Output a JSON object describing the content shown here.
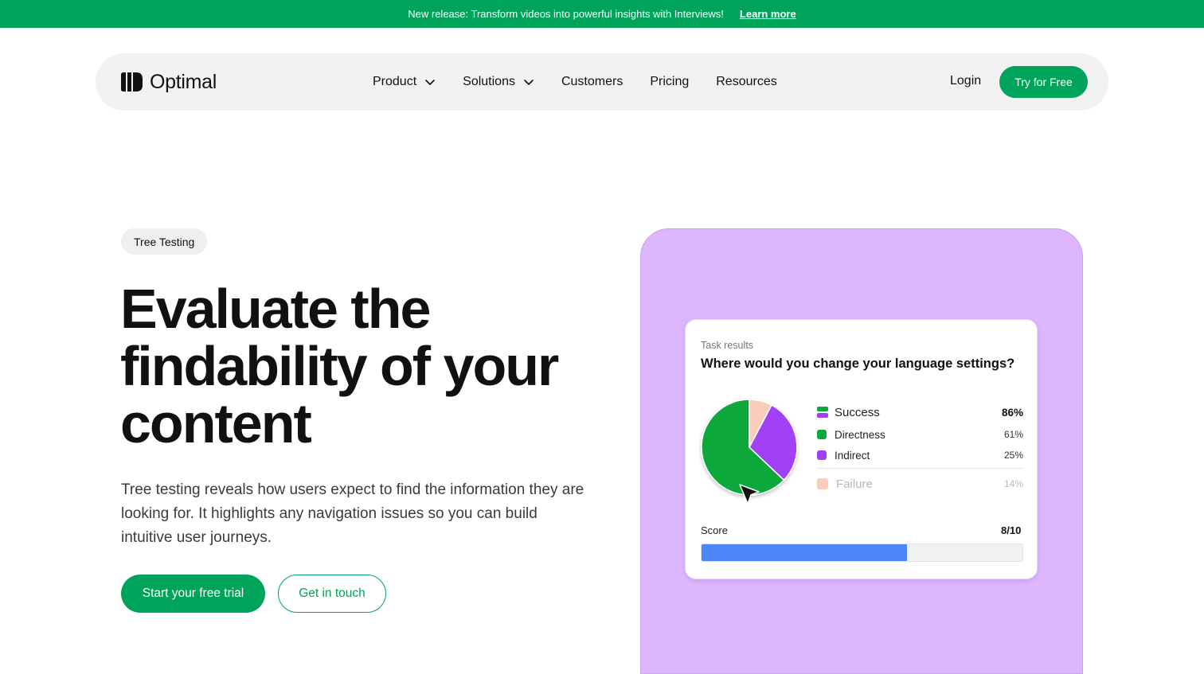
{
  "banner": {
    "message": "New release: Transform videos into powerful insights with Interviews!",
    "link_label": "Learn more",
    "background": "#00A35A"
  },
  "nav": {
    "logo_text": "Optimal",
    "items": [
      {
        "label": "Product",
        "has_dropdown": true
      },
      {
        "label": "Solutions",
        "has_dropdown": true
      },
      {
        "label": "Customers",
        "has_dropdown": false
      },
      {
        "label": "Pricing",
        "has_dropdown": false
      },
      {
        "label": "Resources",
        "has_dropdown": false
      }
    ],
    "login_label": "Login",
    "cta_label": "Try for Free"
  },
  "hero": {
    "tag": "Tree Testing",
    "headline": "Evaluate the findability of your content",
    "description": "Tree testing reveals how users expect to find the information they are looking for. It highlights any navigation issues so you can build intuitive user journeys.",
    "primary_cta": "Start your free trial",
    "secondary_cta": "Get in touch"
  },
  "card": {
    "kicker": "Task results",
    "question": "Where would you change your language settings?",
    "legend": [
      {
        "label": "Success",
        "value": "86%",
        "color": "stack"
      },
      {
        "label": "Directness",
        "value": "61%",
        "color": "#0BA83B"
      },
      {
        "label": "Indirect",
        "value": "25%",
        "color": "#A240F5"
      },
      {
        "label": "Failure",
        "value": "14%",
        "color": "#F9CDBA"
      }
    ],
    "score_label": "Score",
    "score_value": "8/10",
    "score_fraction": 0.64
  },
  "colors": {
    "brand_green": "#00A35A",
    "panel_purple": "#DDB6FC",
    "pie_green": "#0BA83B",
    "pie_purple": "#A240F5",
    "pie_peach": "#F9CDBA",
    "score_blue": "#4C86F9"
  },
  "icons": {
    "cursor": "cursor-arrow-icon",
    "chevron": "chevron-down-icon"
  }
}
